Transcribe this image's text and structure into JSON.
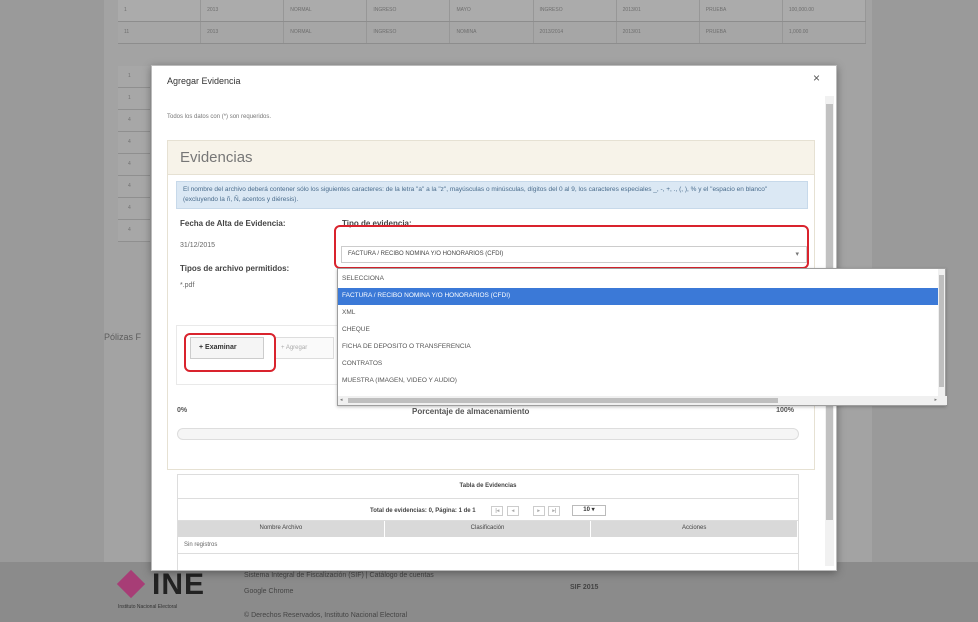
{
  "background": {
    "rows": [
      [
        "1",
        "2013",
        "NORMAL",
        "INGRESO",
        "MAYO",
        "INGRESO",
        "2013/01",
        "PRUEBA",
        "100,000.00"
      ],
      [
        "11",
        "2013",
        "NORMAL",
        "INGRESO",
        "NOMINA",
        "2013/2014",
        "2013/01",
        "PRUEBA",
        "1,000.00"
      ]
    ],
    "side_rows": [
      "1",
      "1",
      "4",
      "4",
      "4",
      "4",
      "4",
      "4"
    ],
    "polizas_label": "Pólizas F",
    "footer": {
      "brand": "INE",
      "brand_sub": "Instituto Nacional Electoral",
      "line1": "Sistema Integral de Fiscalización (SIF) | Catálogo de cuentas",
      "line2": "Google Chrome",
      "line3": "© Derechos Reservados, Instituto Nacional Electoral",
      "version": "SIF 2015"
    }
  },
  "modal": {
    "title": "Agregar Evidencia",
    "close": "×",
    "required_note": "Todos los datos con (*) son requeridos.",
    "panel_title": "Evidencias",
    "info": "El nombre del archivo deberá contener sólo los siguientes caracteres: de la letra \"a\" a la \"z\", mayúsculas o minúsculas, dígitos del 0 al 9, los caracteres especiales _, -, +, ., (, ), % y el \"espacio en blanco\" (excluyendo la ñ, Ñ, acentos y diéresis).",
    "fecha_label": "Fecha de Alta de Evidencia:",
    "fecha_value": "31/12/2015",
    "tipo_label": "Tipo de evidencia:",
    "tipo_selected": "FACTURA / RECIBO NOMINA Y/O HONORARIOS (CFDI)",
    "tipos_archivo_label": "Tipos de archivo permitidos:",
    "tipos_archivo_value": "*.pdf",
    "browse_label": "Examinar",
    "add_label": "Agregar",
    "progress_start": "0%",
    "progress_title": "Porcentaje de almacenamiento",
    "progress_end": "100%",
    "progress_value": 0,
    "table_title": "Tabla de Evidencias",
    "pager_text": "Total de evidencias: 0, Página: 1 de 1",
    "page_size": "10",
    "columns": [
      "Nombre Archivo",
      "Clasificación",
      "Acciones"
    ],
    "empty_text": "Sin registros"
  },
  "dropdown": {
    "options": [
      "SELECCIONA",
      "FACTURA / RECIBO NOMINA Y/O HONORARIOS (CFDI)",
      "XML",
      "CHEQUE",
      "FICHA DE DEPOSITO O TRANSFERENCIA",
      "CONTRATOS",
      "MUESTRA (IMAGEN, VIDEO Y AUDIO)"
    ],
    "selected_index": 1
  },
  "colors": {
    "highlight": "#d9232d",
    "selected": "#3b79d7",
    "brand": "#b0236f"
  }
}
